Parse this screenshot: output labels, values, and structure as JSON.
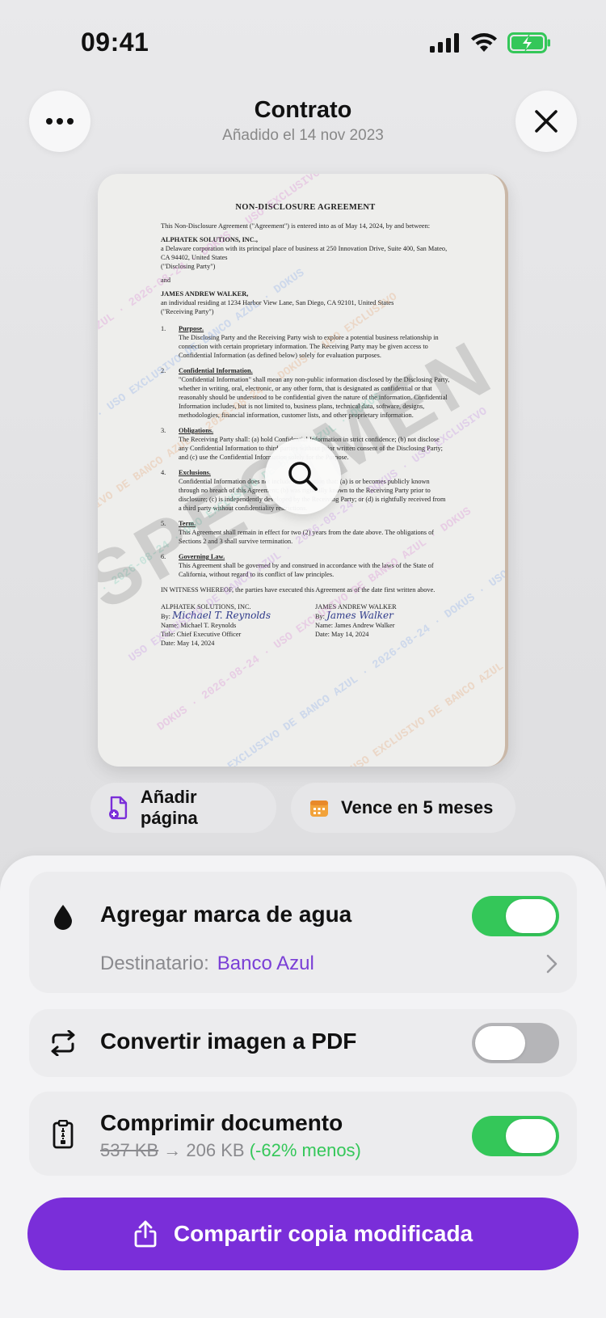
{
  "status_bar": {
    "time": "09:41"
  },
  "header": {
    "title": "Contrato",
    "subtitle": "Añadido el 14 nov 2023"
  },
  "document": {
    "heading": "NON-DISCLOSURE AGREEMENT",
    "intro": "This Non-Disclosure Agreement (\"Agreement\") is entered into as of May 14, 2024, by and between:",
    "party1_name": "ALPHATEK SOLUTIONS, INC.,",
    "party1_desc": "a Delaware corporation with its principal place of business at 250 Innovation Drive, Suite 400, San Mateo, CA 94402, United States",
    "party1_role": "(\"Disclosing Party\")",
    "and": "and",
    "party2_name": "JAMES ANDREW WALKER,",
    "party2_desc": "an individual residing at 1234 Harbor View Lane, San Diego, CA 92101, United States",
    "party2_role": "(\"Receiving Party\")",
    "sections": [
      {
        "num": "1.",
        "title": "Purpose.",
        "body": "The Disclosing Party and the Receiving Party wish to explore a potential business relationship in connection with certain proprietary information. The Receiving Party may be given access to Confidential Information (as defined below) solely for evaluation purposes."
      },
      {
        "num": "2.",
        "title": "Confidential Information.",
        "body": "\"Confidential Information\" shall mean any non-public information disclosed by the Disclosing Party, whether in writing, oral, electronic, or any other form, that is designated as confidential or that reasonably should be understood to be confidential given the nature of the information. Confidential Information includes, but is not limited to, business plans, technical data, software, designs, methodologies, financial information, customer lists, and other proprietary information."
      },
      {
        "num": "3.",
        "title": "Obligations.",
        "body": "The Receiving Party shall: (a) hold Confidential Information in strict confidence; (b) not disclose any Confidential Information to third parties without prior written consent of the Disclosing Party; and (c) use the Confidential Information solely for the Purpose."
      },
      {
        "num": "4.",
        "title": "Exclusions.",
        "body": "Confidential Information does not include information that: (a) is or becomes publicly known through no breach of this Agreement; (b) was rightfully known to the Receiving Party prior to disclosure; (c) is independently developed by the Receiving Party; or (d) is rightfully received from a third party without confidentiality restrictions."
      },
      {
        "num": "5.",
        "title": "Term.",
        "body": "This Agreement shall remain in effect for two (2) years from the date above. The obligations of Sections 2 and 3 shall survive termination."
      },
      {
        "num": "6.",
        "title": "Governing Law.",
        "body": "This Agreement shall be governed by and construed in accordance with the laws of the State of California, without regard to its conflict of law principles."
      }
    ],
    "witness": "IN WITNESS WHEREOF, the parties have executed this Agreement as of the date first written above.",
    "sig_left": {
      "company": "ALPHATEK SOLUTIONS, INC.",
      "by": "By:",
      "signature": "Michael T. Reynolds",
      "name": "Name:   Michael T. Reynolds",
      "title": "Title:    Chief Executive Officer",
      "date": "Date:    May 14, 2024"
    },
    "sig_right": {
      "company": "JAMES ANDREW WALKER",
      "by": "By:",
      "signature": "James Walker",
      "name": "Name:   James Andrew Walker",
      "date": "Date:    May 14, 2024"
    },
    "stamp_text": "SPECIMEN",
    "watermark_text": "USO EXCLUSIVO DE BANCO AZUL · 2026-08-24 · DOKUS"
  },
  "chips": {
    "add_page": "Añadir página",
    "expires": "Vence en 5 meses"
  },
  "options": {
    "watermark": {
      "label": "Agregar marca de agua",
      "recipient_label": "Destinatario:",
      "recipient_value": "Banco Azul",
      "enabled": true
    },
    "convert": {
      "label": "Convertir imagen a PDF",
      "enabled": false
    },
    "compress": {
      "label": "Comprimir documento",
      "size_before": "537 KB",
      "arrow": "→",
      "size_after": "206 KB",
      "saving": "(-62% menos)",
      "enabled": true
    }
  },
  "share_button": {
    "label": "Compartir copia modificada"
  },
  "colors": {
    "accent": "#7a2ed9",
    "toggle_on": "#34c759",
    "toggle_off": "#b5b5b8",
    "recipient": "#7a3fd6"
  },
  "icons": {
    "more": "ellipsis-icon",
    "close": "close-icon",
    "zoom": "magnifier-icon",
    "add_page": "add-page-icon",
    "calendar": "calendar-icon",
    "drop": "water-drop-icon",
    "convert": "convert-arrows-icon",
    "compress": "zip-file-icon",
    "share": "share-icon",
    "chevron": "chevron-right-icon"
  }
}
